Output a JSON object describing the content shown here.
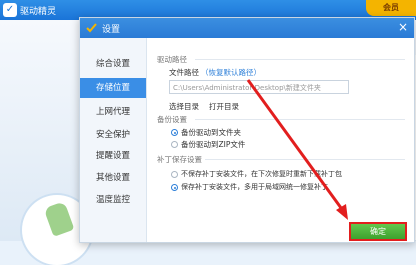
{
  "app": {
    "title": "驱动精灵",
    "badge": "会员"
  },
  "dialog": {
    "title": "设置",
    "close": "×"
  },
  "sidebar": {
    "items": [
      {
        "label": "综合设置"
      },
      {
        "label": "存储位置",
        "active": true
      },
      {
        "label": "上网代理"
      },
      {
        "label": "安全保护"
      },
      {
        "label": "提醒设置"
      },
      {
        "label": "其他设置"
      },
      {
        "label": "温度监控"
      }
    ]
  },
  "driver_path": {
    "section": "驱动路径",
    "file_path_label": "文件路径",
    "restore_link": "（恢复默认路径）",
    "path_value": "C:\\Users\\Administrator\\Desktop\\新建文件夹",
    "choose_dir": "选择目录",
    "open_dir": "打开目录"
  },
  "backup": {
    "section": "备份设置",
    "options": [
      {
        "label": "备份驱动到文件夹",
        "selected": true
      },
      {
        "label": "备份驱动到ZIP文件",
        "selected": false
      }
    ]
  },
  "patch": {
    "section": "补丁保存设置",
    "options": [
      {
        "label": "不保存补丁安装文件，在下次修复时重新下载补丁包",
        "selected": false
      },
      {
        "label": "保存补丁安装文件，多用于局域网统一修复补丁",
        "selected": true
      }
    ]
  },
  "footer": {
    "confirm": "确定"
  },
  "colors": {
    "accent": "#2a7bd6",
    "confirm": "#3ea12e",
    "annotation": "#e21e1e"
  }
}
